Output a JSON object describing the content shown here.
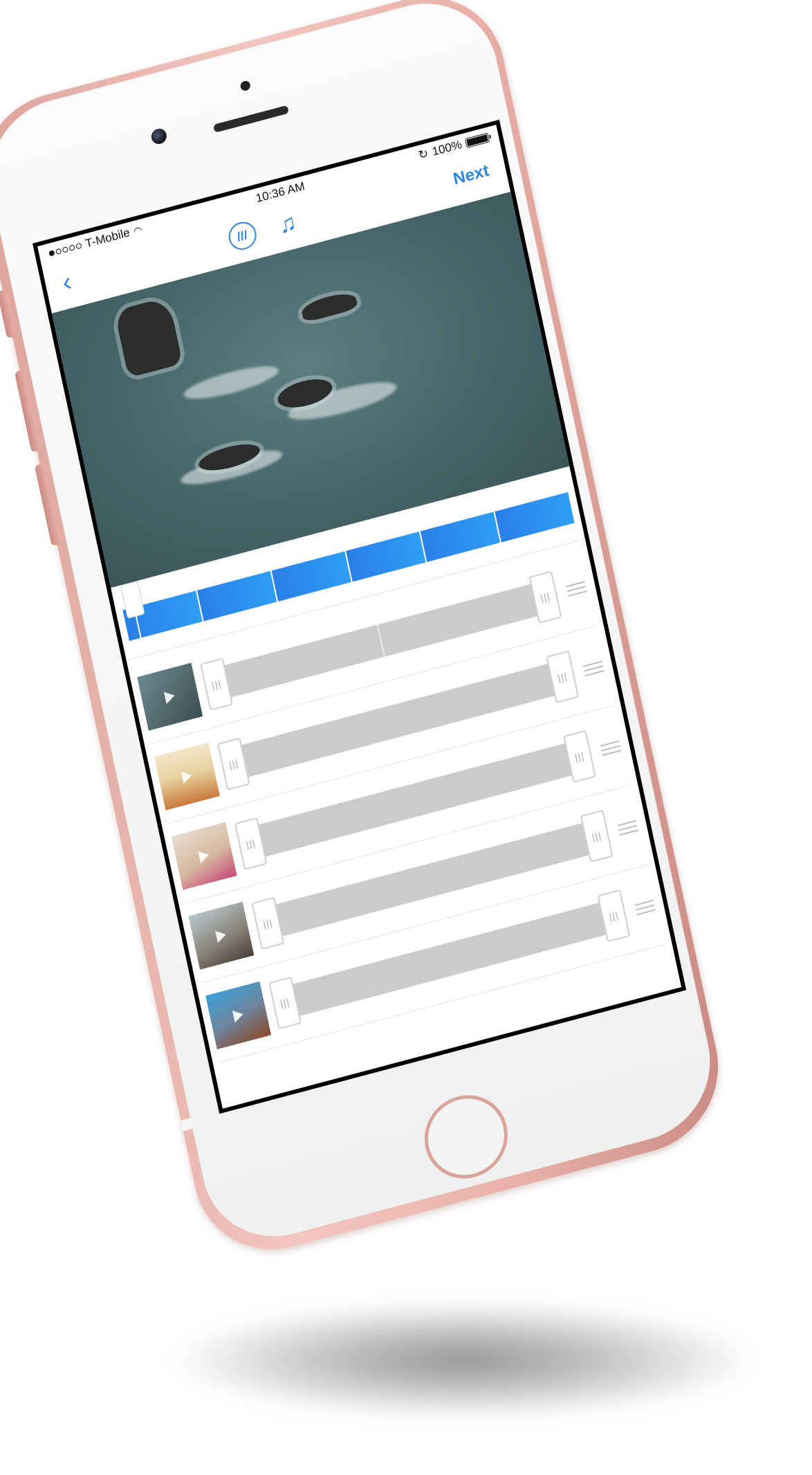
{
  "status_bar": {
    "carrier": "T-Mobile",
    "time": "10:36 AM",
    "battery": "100%"
  },
  "nav": {
    "back_icon": "chevron-left-icon",
    "filter_icon": "filter-circle-icon",
    "music_icon": "music-note-icon",
    "next_label": "Next"
  },
  "preview": {
    "image": "ocean-rocks-photo"
  },
  "timeline": {
    "segments": 6,
    "accent": "#2a7fe8"
  },
  "clips": [
    {
      "thumb": "ocean-rocks-thumb",
      "colors": [
        "#6c8a90",
        "#3d4e51"
      ]
    },
    {
      "thumb": "beach-sunset-thumb",
      "colors": [
        "#f2e5c8",
        "#c97a3b"
      ]
    },
    {
      "thumb": "runner-shoes-thumb",
      "colors": [
        "#e7ddd2",
        "#c64a7a"
      ]
    },
    {
      "thumb": "coast-cliffs-thumb",
      "colors": [
        "#b9c7cf",
        "#4a3f36"
      ]
    },
    {
      "thumb": "building-sky-thumb",
      "colors": [
        "#3aa0d8",
        "#8a4a2a"
      ]
    }
  ]
}
